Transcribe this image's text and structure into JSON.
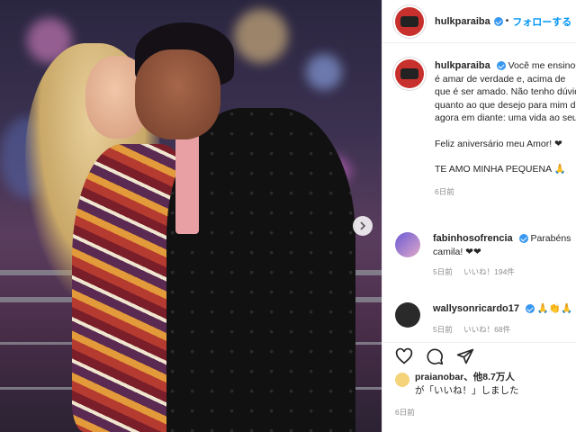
{
  "post": {
    "username": "hulkparaiba",
    "follow_label": "フォローする",
    "caption_lines": [
      "Você me ensinou o que",
      "é amar de verdade e, acima de",
      "que é ser amado. Não tenho dúvidas",
      "quanto ao que desejo para mim de",
      "agora em diante: uma vida ao seu lado."
    ],
    "caption_p2": "Feliz aniversário meu Amor! ❤",
    "caption_p3": "TE AMO MINHA PEQUENA 🙏",
    "caption_time": "6日前"
  },
  "comments": [
    {
      "username": "fabinhosofrencia",
      "text_line1": "Parabéns",
      "text_line2": "camila! ❤❤",
      "time": "5日前",
      "likes": "いいね！194件"
    },
    {
      "username": "wallysonricardo17",
      "text_line1": "🙏👏🙏",
      "time": "5日前",
      "likes": "いいね！68件"
    }
  ],
  "likes_summary": {
    "user": "praianobar",
    "rest": "、他8.7万人",
    "line2": "が「いいね！」しました"
  },
  "post_date": "6日前",
  "icons": [
    "heart-icon",
    "comment-icon",
    "share-icon",
    "chevron-right-icon",
    "verified-badge-icon"
  ],
  "colors": {
    "link": "#0095f6",
    "verified": "#3897f0",
    "heart": "#ed4956"
  }
}
